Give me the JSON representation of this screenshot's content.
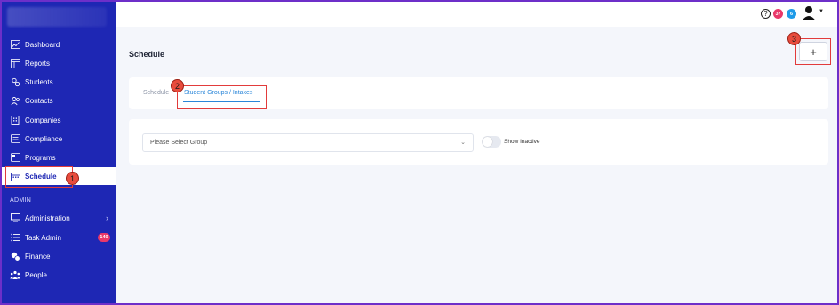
{
  "sidebar": {
    "items": [
      {
        "label": "Dashboard",
        "icon": "chart-line-icon"
      },
      {
        "label": "Reports",
        "icon": "report-table-icon"
      },
      {
        "label": "Students",
        "icon": "students-icon"
      },
      {
        "label": "Contacts",
        "icon": "contacts-icon"
      },
      {
        "label": "Companies",
        "icon": "building-icon"
      },
      {
        "label": "Compliance",
        "icon": "compliance-icon"
      },
      {
        "label": "Programs",
        "icon": "programs-icon"
      },
      {
        "label": "Schedule",
        "icon": "calendar-icon",
        "active": true
      }
    ],
    "admin_label": "ADMIN",
    "admin_items": [
      {
        "label": "Administration",
        "icon": "monitor-icon"
      },
      {
        "label": "Task Admin",
        "icon": "list-icon",
        "badge": "140"
      },
      {
        "label": "Finance",
        "icon": "coins-icon"
      },
      {
        "label": "People",
        "icon": "people-icon"
      }
    ]
  },
  "topbar": {
    "help": "?",
    "notifications_badge": "37",
    "messages_badge": "6"
  },
  "page": {
    "title": "Schedule",
    "add_label": "+"
  },
  "tabs": [
    {
      "label": "Schedule",
      "active": false
    },
    {
      "label": "Student Groups / Intakes",
      "active": true
    }
  ],
  "filter": {
    "group_placeholder": "Please Select Group",
    "show_inactive_label": "Show Inactive",
    "show_inactive_on": false
  },
  "annotations": [
    "1",
    "2",
    "3"
  ],
  "colors": {
    "sidebar": "#1e27b4",
    "accent": "#2a86d9",
    "highlight": "#e23b3b",
    "border": "#6d2fc9"
  }
}
